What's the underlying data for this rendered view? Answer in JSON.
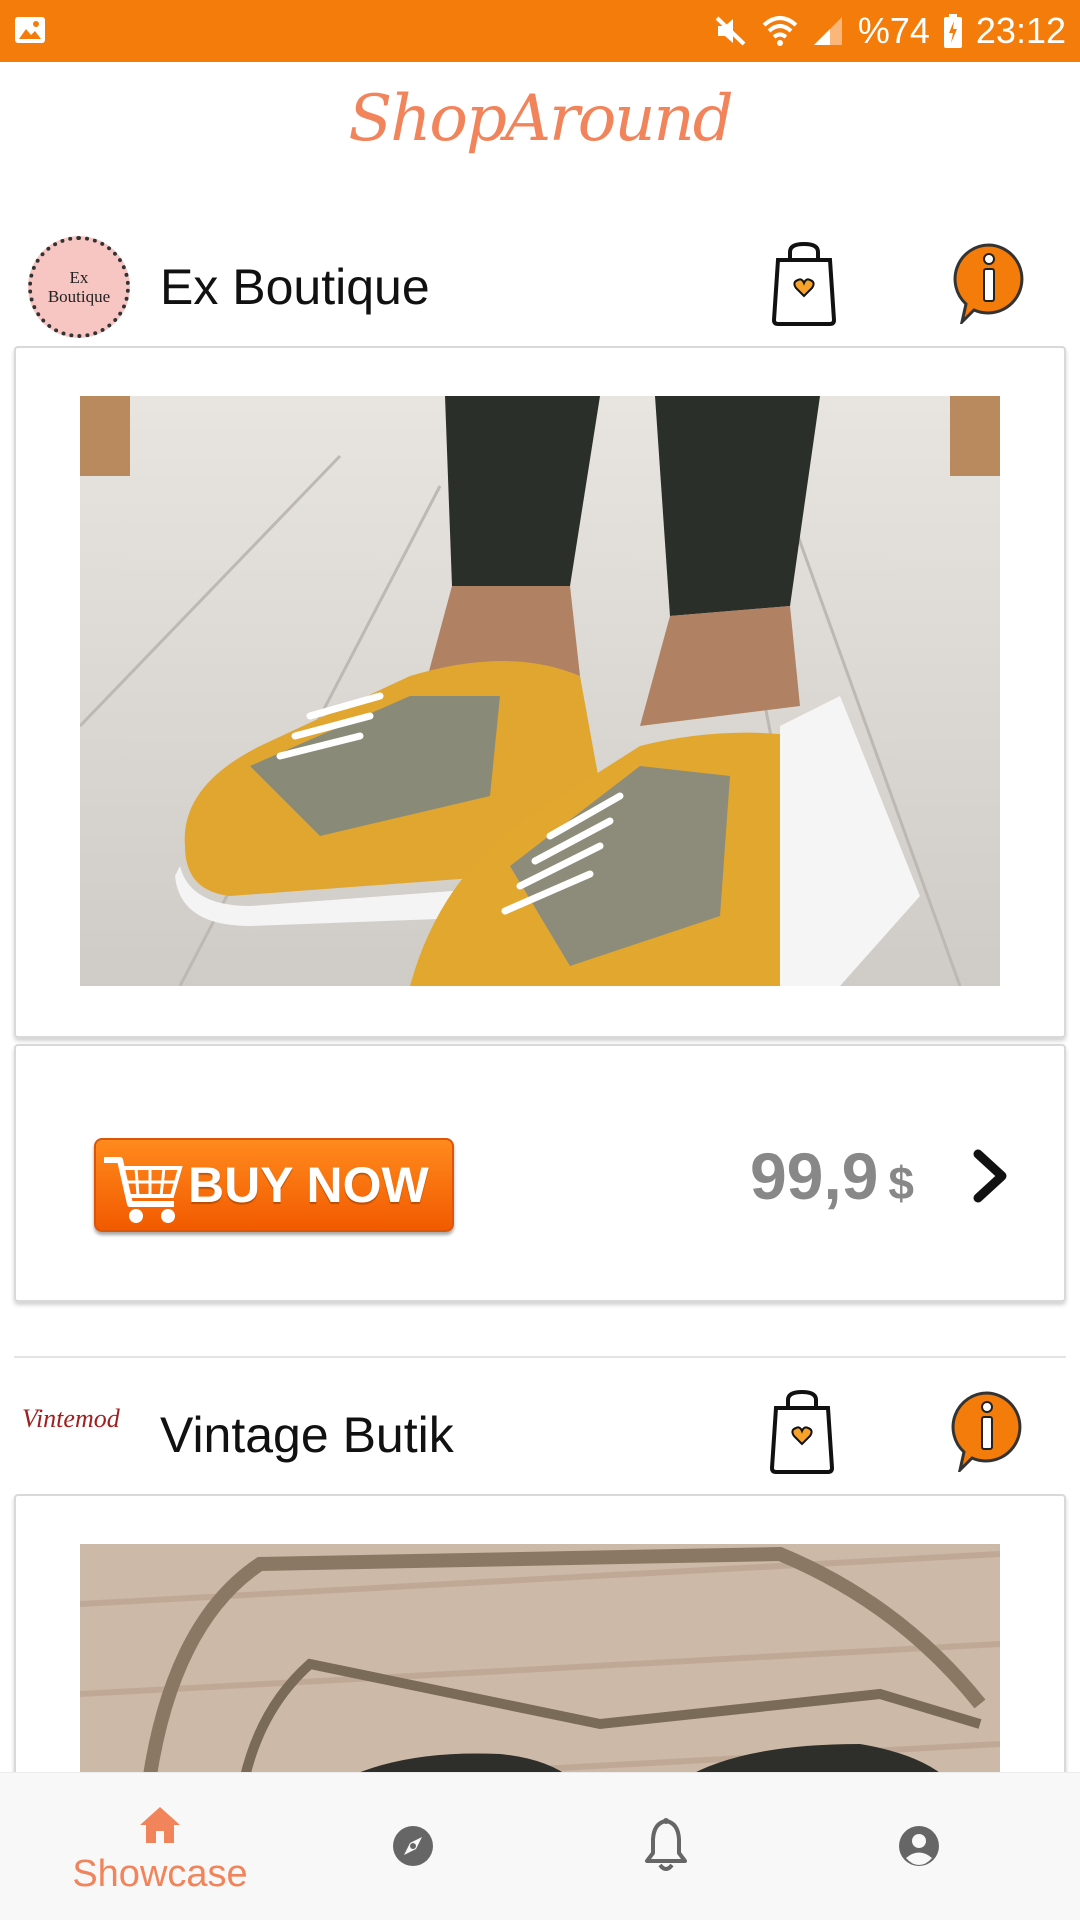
{
  "status_bar": {
    "battery": "%74",
    "time": "23:12"
  },
  "app": {
    "logo_text": "ShopAround"
  },
  "feed": [
    {
      "shop_name": "Ex Boutique",
      "avatar_text": "Ex Boutique",
      "buy_label": "BUY NOW",
      "price": "99,9",
      "currency": "$"
    },
    {
      "shop_name": "Vintage Butik",
      "avatar_text": "Vintemod"
    }
  ],
  "nav": {
    "items": [
      {
        "label": "Showcase",
        "icon": "home-icon",
        "active": true
      },
      {
        "label": "",
        "icon": "compass-icon",
        "active": false
      },
      {
        "label": "",
        "icon": "bell-icon",
        "active": false
      },
      {
        "label": "",
        "icon": "account-icon",
        "active": false
      }
    ]
  },
  "colors": {
    "accent": "#f47c0a",
    "logo": "#f2845c",
    "price": "#888888"
  }
}
